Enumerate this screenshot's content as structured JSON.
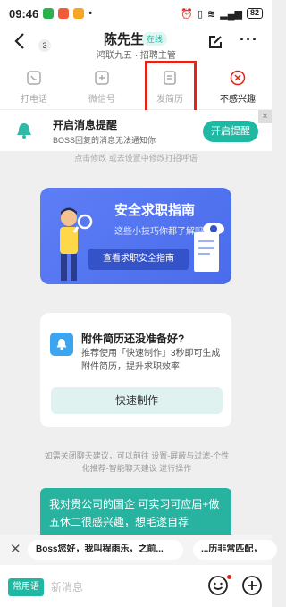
{
  "status_bar": {
    "time": "09:46",
    "battery": "82"
  },
  "header": {
    "unread_count": "3",
    "name": "陈先生",
    "online": "在线",
    "subtitle": "鸿联九五 · 招聘主管"
  },
  "actions": [
    {
      "label": "打电话",
      "icon": "phone-icon"
    },
    {
      "label": "微信号",
      "icon": "wechat-icon"
    },
    {
      "label": "发简历",
      "icon": "resume-icon"
    },
    {
      "label": "不感兴趣",
      "icon": "not-interested-icon"
    }
  ],
  "notify": {
    "title": "开启消息提醒",
    "subtitle": "BOSS回复的消息无法通知你",
    "button": "开启提醒",
    "close": "×"
  },
  "hint_top": "点击修改 或去设置中修改打招呼语",
  "guide": {
    "title": "安全求职指南",
    "subtitle": "这些小技巧你都了解吗?",
    "button": "查看求职安全指南"
  },
  "resume_card": {
    "title": "附件简历还没准备好?",
    "desc": "推荐使用「快速制作」3秒即可生成附件简历，提升求职效率",
    "button": "快速制作"
  },
  "hint_bottom": "如需关闭聊天建议，可以前往 设置-屏蔽与过滤-个性化推荐-智能聊天建议 进行操作",
  "message": "我对贵公司的国企 可实习可应届+做五休二很感兴趣，想毛遂自荐",
  "quick_replies": [
    "Boss您好，我叫程雨乐，之前...",
    "...历非常匹配，"
  ],
  "input": {
    "phrase_button": "常用语",
    "placeholder": "新消息"
  },
  "colors": {
    "accent": "#1fb8a3",
    "highlight": "#e1251b",
    "banner": "#4a6cec"
  }
}
